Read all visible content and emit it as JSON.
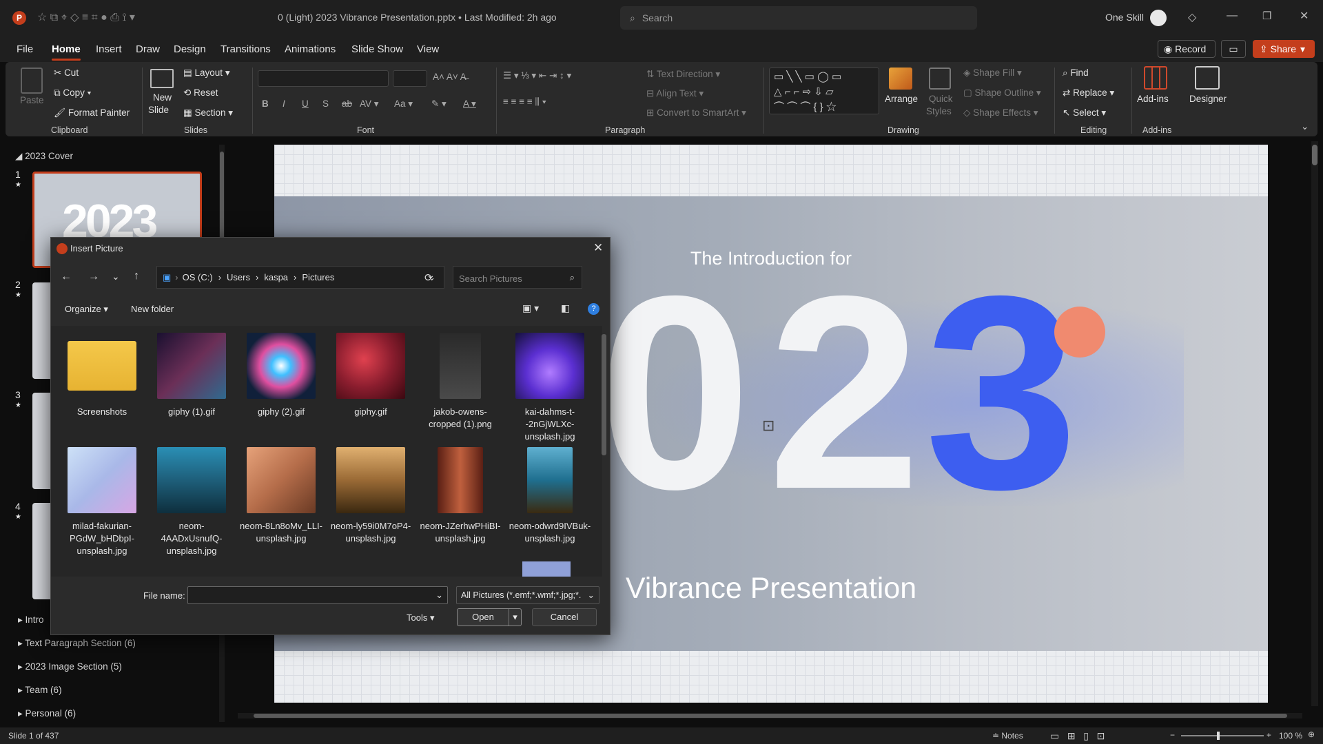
{
  "window": {
    "title": "0 (Light) 2023 Vibrance Presentation.pptx • Last Modified: 2h ago",
    "search_placeholder": "Search",
    "user": "One Skill"
  },
  "menu": [
    "File",
    "Home",
    "Insert",
    "Draw",
    "Design",
    "Transitions",
    "Animations",
    "Slide Show",
    "View"
  ],
  "actions": {
    "record": "Record",
    "share": "Share"
  },
  "ribbon": {
    "clipboard": {
      "paste": "Paste",
      "cut": "Cut",
      "copy": "Copy",
      "format_painter": "Format Painter",
      "label": "Clipboard"
    },
    "slides": {
      "new_slide_1": "New",
      "new_slide_2": "Slide",
      "layout": "Layout",
      "reset": "Reset",
      "section": "Section",
      "label": "Slides"
    },
    "font": {
      "label": "Font"
    },
    "paragraph": {
      "text_direction": "Text Direction",
      "align_text": "Align Text",
      "convert": "Convert to SmartArt",
      "label": "Paragraph"
    },
    "drawing": {
      "arrange": "Arrange",
      "quick_1": "Quick",
      "quick_2": "Styles",
      "shape_fill": "Shape Fill",
      "shape_outline": "Shape Outline",
      "shape_effects": "Shape Effects",
      "label": "Drawing"
    },
    "editing": {
      "find": "Find",
      "replace": "Replace",
      "select": "Select",
      "label": "Editing"
    },
    "addins": {
      "addins": "Add-ins",
      "designer": "Designer",
      "label": "Add-ins"
    }
  },
  "slide_panel": {
    "top_section": "2023 Cover",
    "slide_numbers": [
      "1",
      "2",
      "3",
      "4"
    ],
    "sections": [
      "Intro",
      "Text Paragraph Section (6)",
      "2023 Image Section (5)",
      "Team (6)",
      "Personal (6)"
    ],
    "thumb_year": "2023"
  },
  "slide": {
    "subtitle": "The Introduction for",
    "year_a": "0",
    "year_b": "2",
    "year_c": "3",
    "title": "Vibrance Presentation"
  },
  "dialog": {
    "title": "Insert Picture",
    "path": [
      "OS (C:)",
      "Users",
      "kaspa",
      "Pictures"
    ],
    "search_placeholder": "Search Pictures",
    "organize": "Organize",
    "new_folder": "New folder",
    "files": [
      {
        "name": "Screenshots",
        "kind": "folder"
      },
      {
        "name": "giphy (1).gif",
        "kind": "image",
        "color": "#6b2f57"
      },
      {
        "name": "giphy (2).gif",
        "kind": "image",
        "color": "#2a76b5"
      },
      {
        "name": "giphy.gif",
        "kind": "image",
        "color": "#8a1d2e"
      },
      {
        "name": "jakob-owens-cropped (1).png",
        "kind": "image",
        "color": "#3a3a3a"
      },
      {
        "name": "kai-dahms-t--2nGjWLXc-unsplash.jpg",
        "kind": "image",
        "color": "#5b2fd1"
      },
      {
        "name": "milad-fakurian-PGdW_bHDbpI-unsplash.jpg",
        "kind": "image",
        "color": "#a9b8e8"
      },
      {
        "name": "neom-4AADxUsnufQ-unsplash.jpg",
        "kind": "image",
        "color": "#1e5f7a"
      },
      {
        "name": "neom-8Ln8oMv_LLI-unsplash.jpg",
        "kind": "image",
        "color": "#b56d4a"
      },
      {
        "name": "neom-ly59i0M7oP4-unsplash.jpg",
        "kind": "image",
        "color": "#9a6a35"
      },
      {
        "name": "neom-JZerhwPHiBI-unsplash.jpg",
        "kind": "image",
        "color": "#a0452e"
      },
      {
        "name": "neom-odwrd9IVBuk-unsplash.jpg",
        "kind": "image",
        "color": "#1f6f8f"
      }
    ],
    "file_name_label": "File name:",
    "file_name_value": "",
    "filter": "All Pictures (*.emf;*.wmf;*.jpg;*.",
    "tools": "Tools",
    "open": "Open",
    "cancel": "Cancel"
  },
  "status": {
    "slide": "Slide 1 of 437",
    "notes": "Notes",
    "zoom": "100 %"
  },
  "colors": {
    "accent": "#c43e1c",
    "blue3": "#3d5ef0",
    "coral": "#f08a6f"
  }
}
